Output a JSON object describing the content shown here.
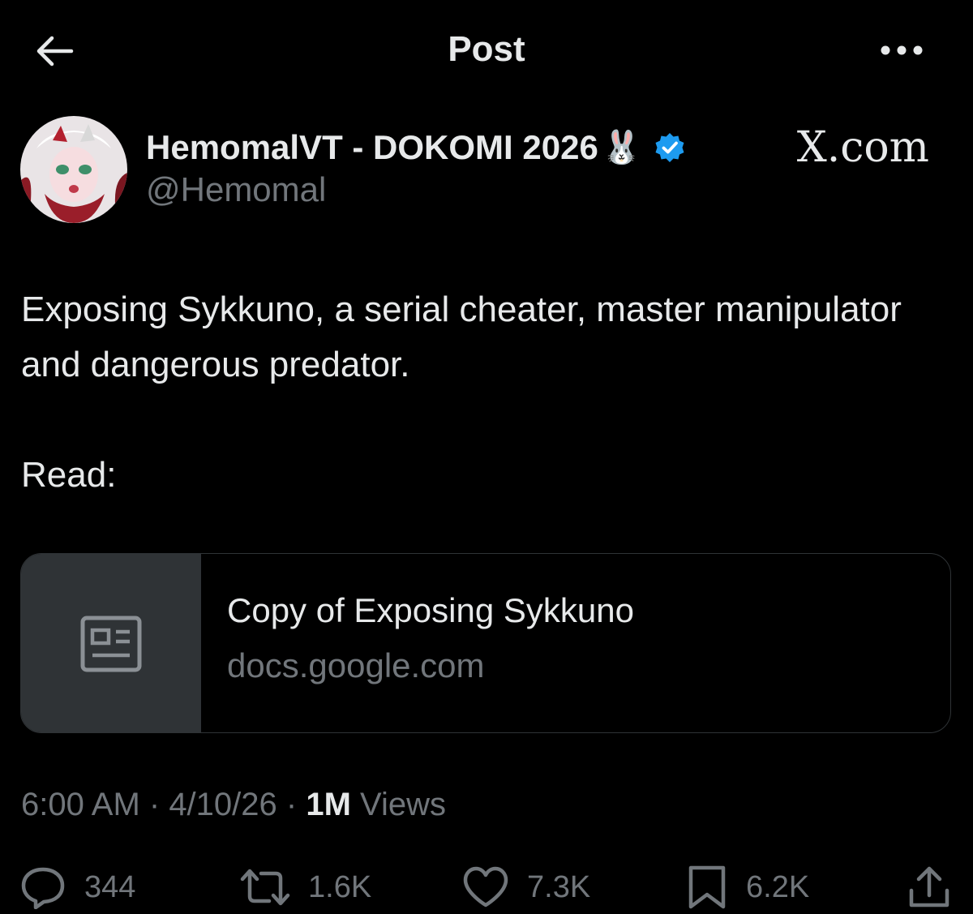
{
  "header": {
    "title": "Post",
    "back_icon": "arrow-left-icon",
    "more_icon": "more-horizontal-icon"
  },
  "author": {
    "display_name": "HemomalVT - DOKOMI 2026",
    "emoji": "🐰",
    "handle": "@Hemomal",
    "verified": true,
    "verified_color": "#1d9bf0"
  },
  "source_label": "X.com",
  "post": {
    "line1": "Exposing Sykkuno, a serial cheater, master manipulator and dangerous predator.",
    "line2": "Read:"
  },
  "link_card": {
    "title": "Copy of Exposing Sykkuno",
    "domain": "docs.google.com",
    "thumb_icon": "article-icon"
  },
  "meta": {
    "time": "6:00 AM",
    "sep1": " · ",
    "date": "4/10/26",
    "sep2": " · ",
    "views_count": "1M",
    "views_label": " Views"
  },
  "actions": {
    "replies": "344",
    "reposts": "1.6K",
    "likes": "7.3K",
    "bookmarks": "6.2K"
  },
  "colors": {
    "background": "#000000",
    "text_primary": "#e7e9ea",
    "text_secondary": "#71767b",
    "border": "#2f3336"
  }
}
